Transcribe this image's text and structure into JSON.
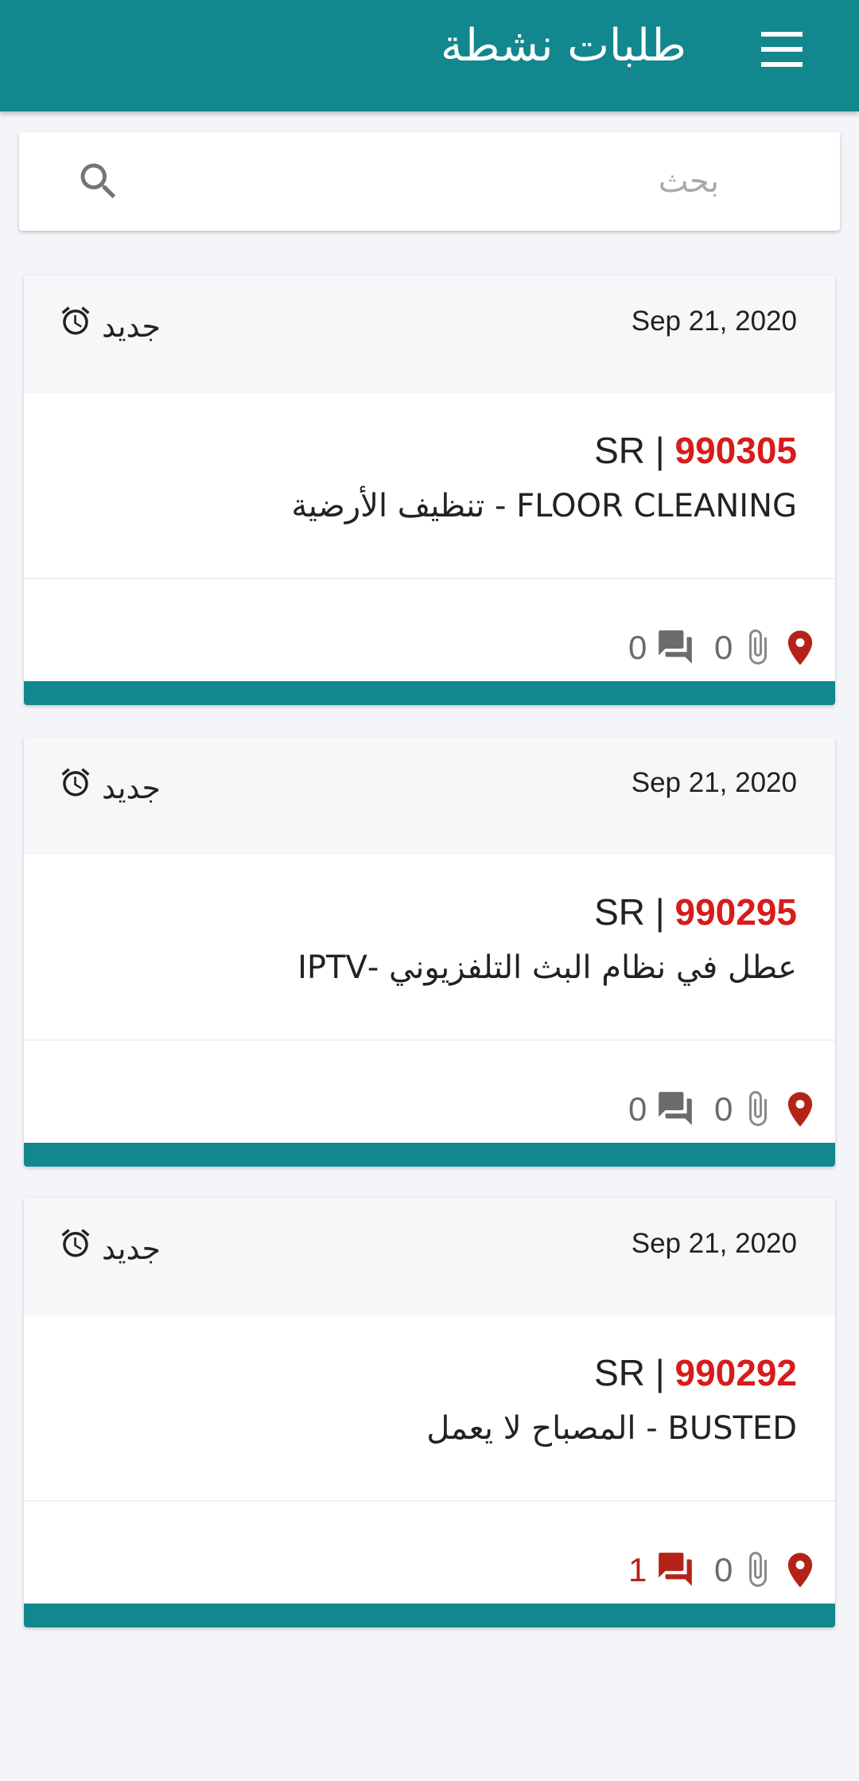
{
  "appbar": {
    "title": "طلبات نشطة"
  },
  "search": {
    "placeholder": "بحث"
  },
  "colors": {
    "primary": "#12878e",
    "sr_number": "#d81b1b",
    "location": "#b42318"
  },
  "icons": {
    "menu": "menu-icon",
    "search": "search-icon",
    "alarm": "alarm-clock-icon",
    "comment": "comment-icon",
    "attachment": "paperclip-icon",
    "location": "location-pin-icon"
  },
  "requests": [
    {
      "date": "Sep 21, 2020",
      "status": "جديد",
      "sr_prefix": "SR | ",
      "sr_number": "990305",
      "description": "FLOOR CLEANING - تنظيف الأرضية",
      "comments": "0",
      "attachments": "0"
    },
    {
      "date": "Sep 21, 2020",
      "status": "جديد",
      "sr_prefix": "SR | ",
      "sr_number": "990295",
      "description": "عطل في نظام البث التلفزيوني -IPTV",
      "comments": "0",
      "attachments": "0"
    },
    {
      "date": "Sep 21, 2020",
      "status": "جديد",
      "sr_prefix": "SR | ",
      "sr_number": "990292",
      "description": "BUSTED - المصباح لا يعمل",
      "comments": "1",
      "attachments": "0"
    }
  ]
}
